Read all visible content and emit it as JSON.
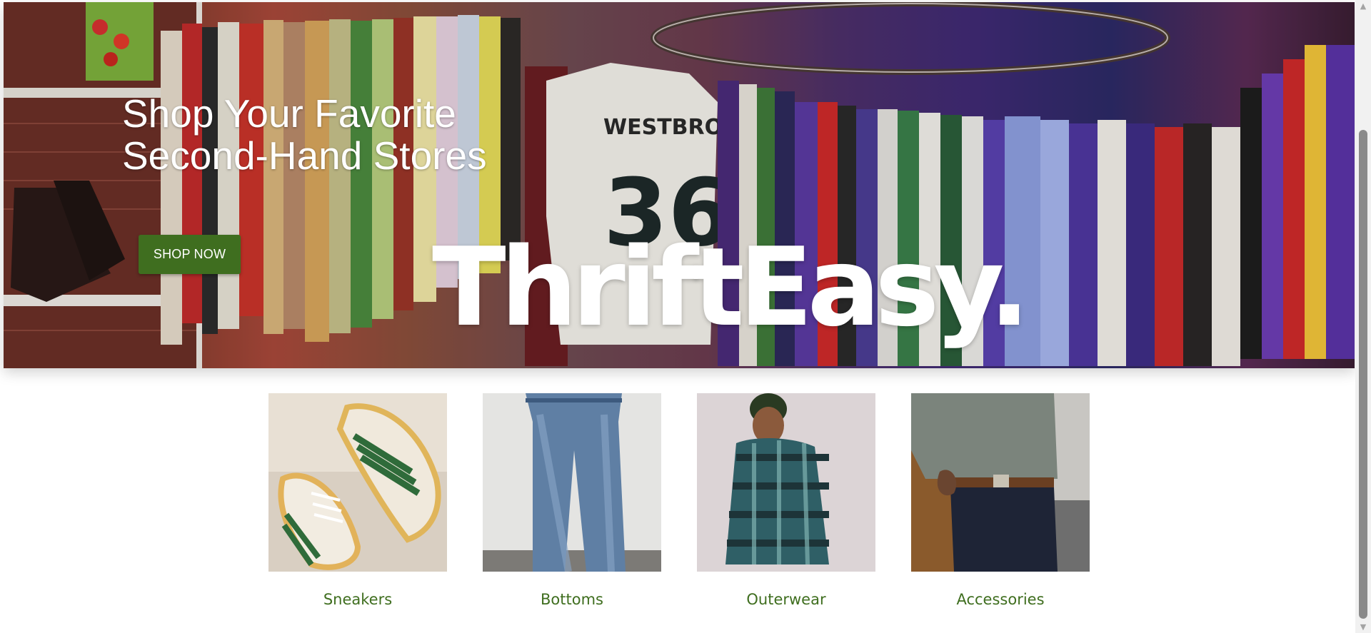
{
  "hero": {
    "title": "Shop Your Favorite\nSecond-Hand Stores",
    "button_label": "SHOP NOW",
    "logo_text": "ThriftEasy.",
    "jersey_text": "WESTBROOK",
    "jersey_number": "36"
  },
  "categories": [
    {
      "label": "Sneakers",
      "image": "sneakers-photo"
    },
    {
      "label": "Bottoms",
      "image": "jeans-photo"
    },
    {
      "label": "Outerwear",
      "image": "flannel-jacket-photo"
    },
    {
      "label": "Accessories",
      "image": "belt-sweater-photo"
    }
  ],
  "scrollbar": {
    "up_icon": "▲",
    "down_icon": "▼"
  },
  "colors": {
    "accent": "#3f6e1f",
    "background": "#ffffff"
  }
}
